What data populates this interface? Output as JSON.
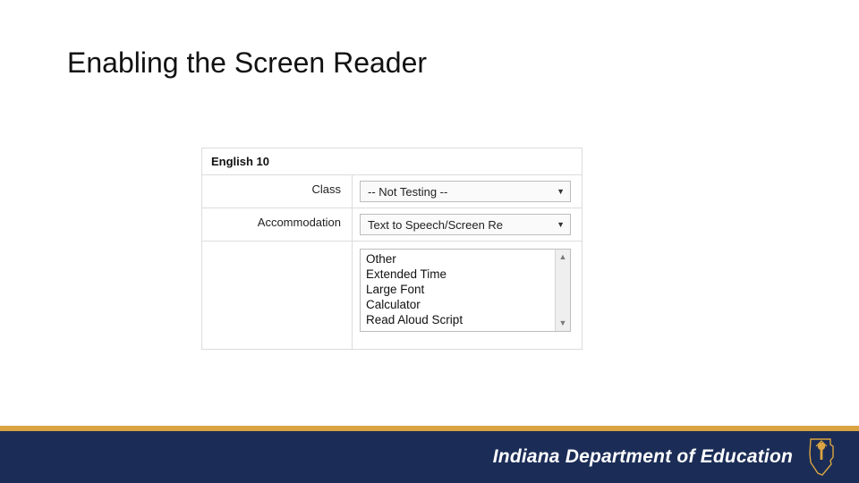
{
  "title": "Enabling the Screen Reader",
  "panel": {
    "header": "English 10",
    "class": {
      "label": "Class",
      "selected": "-- Not Testing --"
    },
    "accommodation": {
      "label": "Accommodation",
      "selected": "Text to Speech/Screen Re",
      "options": [
        "Other",
        "Extended Time",
        "Large Font",
        "Calculator",
        "Read Aloud Script"
      ]
    }
  },
  "footer": {
    "brand": "Indiana Department of Education",
    "colors": {
      "bar": "#1b2d57",
      "stripe": "#d9a441"
    }
  }
}
